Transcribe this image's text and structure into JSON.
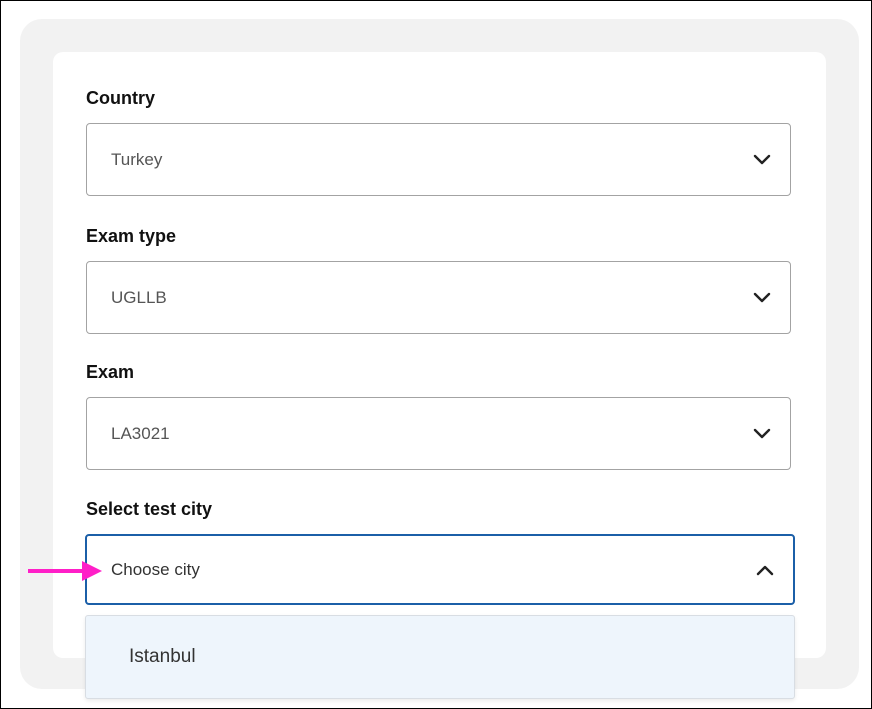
{
  "form": {
    "country": {
      "label": "Country",
      "value": "Turkey"
    },
    "exam_type": {
      "label": "Exam type",
      "value": "UGLLB"
    },
    "exam": {
      "label": "Exam",
      "value": "LA3021"
    },
    "test_city": {
      "label": "Select test city",
      "placeholder": "Choose city",
      "expanded": true,
      "options": [
        "Istanbul"
      ]
    }
  },
  "annotation": {
    "arrow_color": "#ff1fc8"
  },
  "colors": {
    "focus_border": "#1b5fa8",
    "option_highlight": "#eef5fc"
  }
}
